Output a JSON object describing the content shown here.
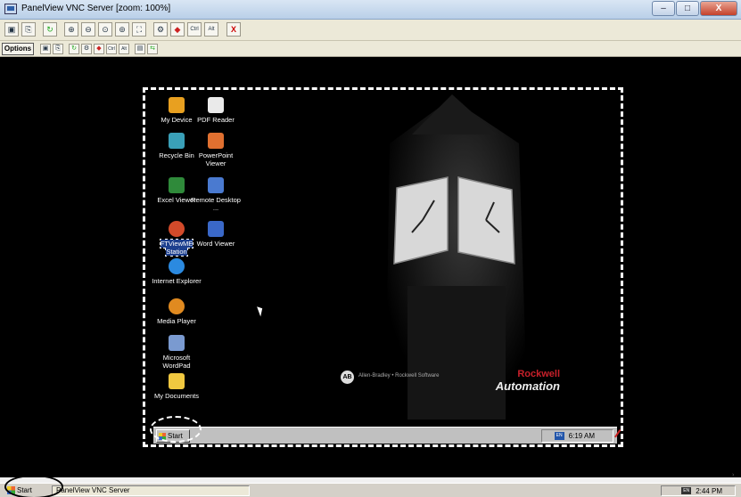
{
  "window": {
    "title": "PanelView VNC Server [zoom: 100%]"
  },
  "window_buttons": {
    "minimize": "–",
    "maximize": "□",
    "close": "X"
  },
  "toolbar1": {
    "icons": [
      "save-icon",
      "copy-icon",
      "refresh-icon",
      "zoom-in-icon",
      "zoom-out-icon",
      "zoom-100-icon",
      "zoom-fit-icon",
      "fullscreen-icon",
      "ctrl-alt-del-icon",
      "ctrl-esc-icon",
      "ctrl-key-icon",
      "alt-key-icon",
      "disconnect-icon"
    ],
    "ctrl_label": "Ctrl",
    "alt_label": "Alt",
    "close_label": "X"
  },
  "toolbar2": {
    "options_label": "Options",
    "ctrl_label": "Ctrl",
    "alt_label": "Alt"
  },
  "desktop_icons": [
    {
      "label": "My Device"
    },
    {
      "label": "PDF Reader"
    },
    {
      "label": "Recycle Bin"
    },
    {
      "label": "PowerPoint Viewer"
    },
    {
      "label": "Excel Viewer"
    },
    {
      "label": "Remote Desktop ..."
    },
    {
      "label": "FTViewME Station"
    },
    {
      "label": "Word Viewer"
    },
    {
      "label": "Internet Explorer"
    },
    {
      "label": "Media Player"
    },
    {
      "label": "Microsoft WordPad"
    },
    {
      "label": "My Documents"
    }
  ],
  "branding": {
    "ab_logo": "AB",
    "ab_text": "Allen-Bradley • Rockwell Software",
    "rockwell": "Rockwell",
    "automation": "Automation"
  },
  "inner_taskbar": {
    "start": "Start",
    "time": "6:19 AM",
    "lang": "EN"
  },
  "outer_taskbar": {
    "start": "Start",
    "task": "PanelView VNC Server",
    "time": "2:44 PM",
    "lang": "EN"
  }
}
